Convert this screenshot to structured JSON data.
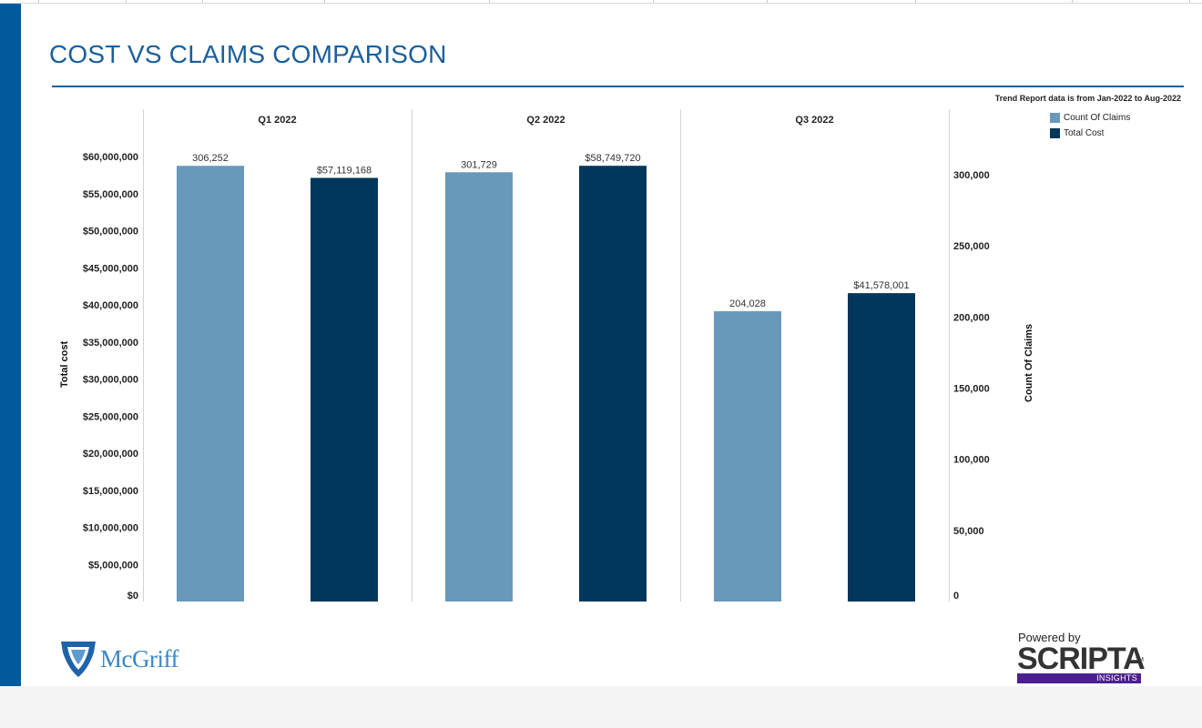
{
  "page": {
    "title": "COST VS CLAIMS COMPARISON",
    "note": "Trend Report data is from Jan-2022 to Aug-2022",
    "logo_left": "McGriff",
    "logo_left_icon": "shield-icon",
    "logo_right_powered": "Powered by",
    "logo_right_name": "SCRIPTA",
    "logo_right_tm": "TM",
    "logo_right_sub": "INSIGHTS"
  },
  "colors": {
    "accent": "#005a9c",
    "title": "#1b5e9a",
    "count_of_claims": "#6899ba",
    "total_cost": "#00375b",
    "insights": "#4b1f8f"
  },
  "chart_data": {
    "type": "bar",
    "categories": [
      "Q1 2022",
      "Q2 2022",
      "Q3 2022"
    ],
    "series": [
      {
        "name": "Count Of Claims",
        "axis": "right",
        "values": [
          306252,
          301729,
          204028
        ],
        "labels": [
          "306,252",
          "301,729",
          "204,028"
        ],
        "color": "#6899ba"
      },
      {
        "name": "Total Cost",
        "axis": "left",
        "values": [
          57119168,
          58749720,
          41578001
        ],
        "labels": [
          "$57,119,168",
          "$58,749,720",
          "$41,578,001"
        ],
        "color": "#00375b"
      }
    ],
    "ylabel": "Total cost",
    "ylabel_right": "Count Of Claims",
    "ylim": [
      0,
      60000000
    ],
    "ylim_right": [
      0,
      300000
    ],
    "yticks": [
      "$0",
      "$5,000,000",
      "$10,000,000",
      "$15,000,000",
      "$20,000,000",
      "$25,000,000",
      "$30,000,000",
      "$35,000,000",
      "$40,000,000",
      "$45,000,000",
      "$50,000,000",
      "$55,000,000",
      "$60,000,000"
    ],
    "yticks_right": [
      "0",
      "50,000",
      "100,000",
      "150,000",
      "200,000",
      "250,000",
      "300,000"
    ],
    "legend": "top-right",
    "grid": false
  }
}
